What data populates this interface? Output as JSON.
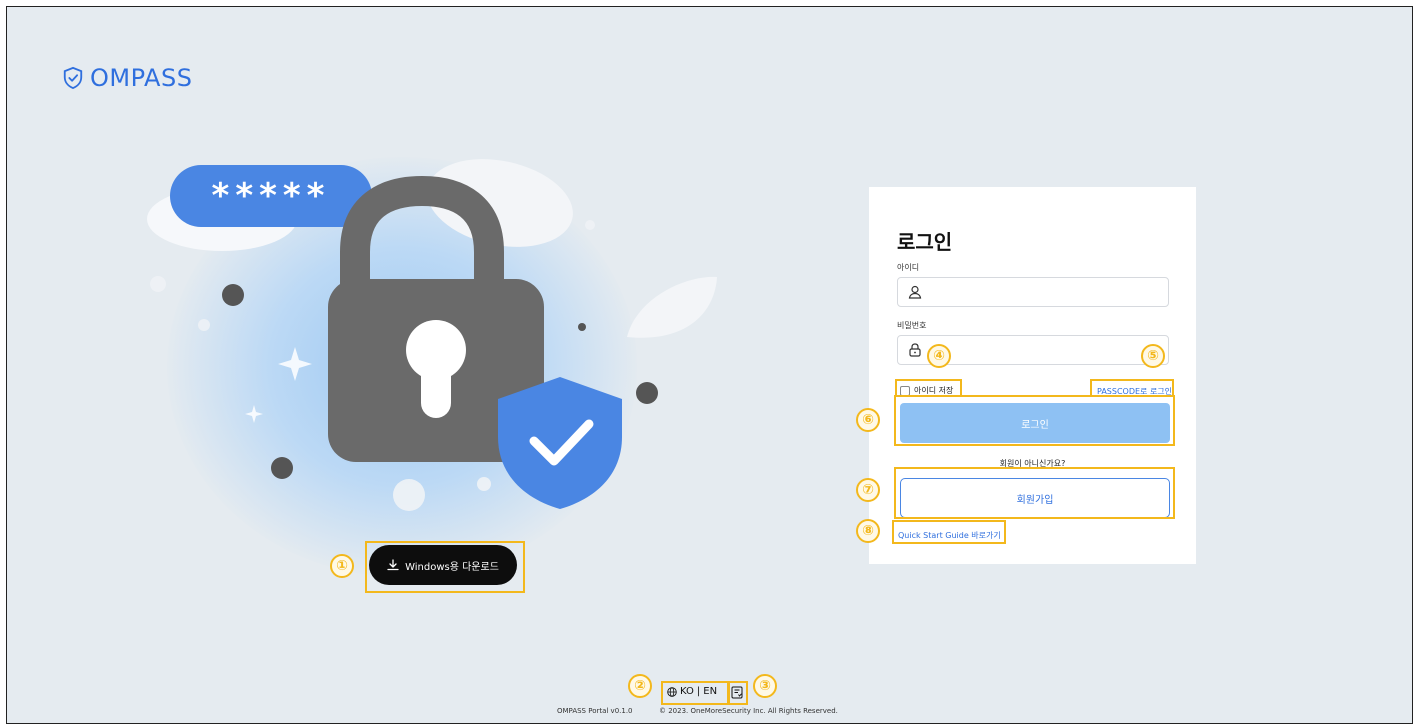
{
  "brand": {
    "name": "OMPASS",
    "color": "#2f6fde"
  },
  "hero": {
    "password_mask": "*****",
    "icons": [
      "padlock-icon",
      "shield-check-icon"
    ]
  },
  "download": {
    "label": "Windows용 다운로드",
    "icon": "download-icon"
  },
  "login": {
    "title": "로그인",
    "id_label": "아이디",
    "id_value": "",
    "password_label": "비밀번호",
    "password_value": "",
    "remember_label": "아이디 저장",
    "passcode_link": "PASSCODE로 로그인",
    "login_button": "로그인",
    "not_member": "회원이 아니신가요?",
    "signup_button": "회원가입",
    "quick_start": "Quick Start Guide 바로가기"
  },
  "footer": {
    "lang_ko": "KO",
    "lang_sep": "|",
    "lang_en": "EN",
    "version": "OMPASS Portal v0.1.0",
    "copyright": "© 2023. OneMoreSecurity Inc. All Rights Reserved."
  },
  "annotations": [
    "①",
    "②",
    "③",
    "④",
    "⑤",
    "⑥",
    "⑦",
    "⑧"
  ],
  "colors": {
    "accent": "#2f6fde",
    "highlight": "#f3b81c",
    "login_button": "#8ec1f3",
    "background": "#e5ebf0"
  }
}
